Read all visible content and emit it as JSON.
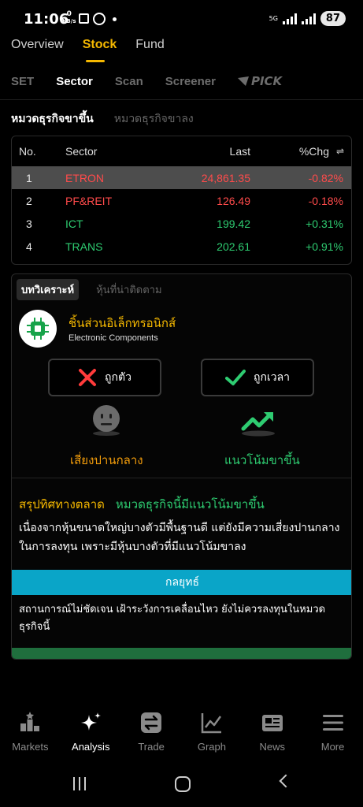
{
  "status_bar": {
    "time": "11:06",
    "net_speed_value": "0",
    "net_speed_unit": "KB/s",
    "net_type": "5G",
    "battery": "87"
  },
  "top_tabs": [
    "Overview",
    "Stock",
    "Fund"
  ],
  "top_tab_active": "Stock",
  "sub_tabs": [
    "SET",
    "Sector",
    "Scan",
    "Screener"
  ],
  "sub_tab_active": "Sector",
  "pick_label": "PICK",
  "sector_tabs": {
    "up": "หมวดธุรกิจขาขึ้น",
    "down": "หมวดธุรกิจขาลง"
  },
  "table": {
    "headers": {
      "no": "No.",
      "sector": "Sector",
      "last": "Last",
      "chg": "%Chg"
    },
    "rows": [
      {
        "no": "1",
        "sector": "ETRON",
        "last": "24,861.35",
        "chg": "-0.82%",
        "direction": "down"
      },
      {
        "no": "2",
        "sector": "PF&REIT",
        "last": "126.49",
        "chg": "-0.18%",
        "direction": "down"
      },
      {
        "no": "3",
        "sector": "ICT",
        "last": "199.42",
        "chg": "+0.31%",
        "direction": "up"
      },
      {
        "no": "4",
        "sector": "TRANS",
        "last": "202.61",
        "chg": "+0.91%",
        "direction": "up"
      }
    ]
  },
  "analysis": {
    "tab_active": "บทวิเคราะห์",
    "tab_other": "หุ้นที่น่าติดตาม",
    "sector_name_th": "ชิ้นส่วนอิเล็กทรอนิกส์",
    "sector_name_en": "Electronic Components",
    "vote_wrong": "ถูกตัว",
    "vote_right": "ถูกเวลา",
    "risk_label": "เสี่ยงปานกลาง",
    "trend_label": "แนวโน้มขาขึ้น",
    "summary_heading": "สรุปทิศทางตลาด",
    "summary_tag": "หมวดธุรกิจนี้มีแนวโน้มขาขึ้น",
    "summary_text": "เนื่องจากหุ้นขนาดใหญ่บางตัวมีพื้นฐานดี แต่ยังมีความเสี่ยงปานกลาง ในการลงทุน เพราะมีหุ้นบางตัวที่มีแนวโน้มขาลง",
    "strategy_title": "กลยุทธ์",
    "strategy_text": "สถานการณ์ไม่ชัดเจน เฝ้าระวังการเคลื่อนไหว ยังไม่ควรลงทุนในหมวดธุรกิจนี้"
  },
  "bottom_nav": [
    {
      "label": "Markets",
      "icon": "markets-podium-icon"
    },
    {
      "label": "Analysis",
      "icon": "analysis-sparkle-icon"
    },
    {
      "label": "Trade",
      "icon": "trade-arrows-icon"
    },
    {
      "label": "Graph",
      "icon": "graph-line-icon"
    },
    {
      "label": "News",
      "icon": "news-paper-icon"
    },
    {
      "label": "More",
      "icon": "menu-icon"
    }
  ],
  "bottom_nav_active": "Analysis",
  "colors": {
    "accent": "#f5b800",
    "down": "#ff4b4b",
    "up": "#2ecc71",
    "strategy_bar": "#0aa5c8"
  }
}
